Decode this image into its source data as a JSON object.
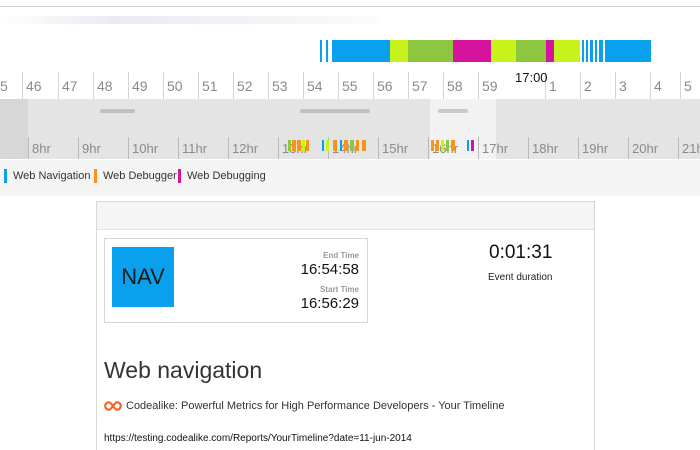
{
  "colors": {
    "web_navigation": "#09a1ee",
    "web_debugger": "#f7941d",
    "web_debugging": "#d6139e",
    "lime": "#c8f21c",
    "olive": "#8dc63f"
  },
  "timeline": {
    "current_time_label": "17:00",
    "minute_labels": [
      "5",
      "46",
      "47",
      "48",
      "49",
      "50",
      "51",
      "52",
      "53",
      "54",
      "55",
      "56",
      "57",
      "58",
      "59",
      "1",
      "2",
      "3",
      "4",
      "5"
    ],
    "hour_labels": [
      "8hr",
      "9hr",
      "10hr",
      "11hr",
      "12hr",
      "13hr",
      "14hr",
      "15hr",
      "16hr",
      "17hr",
      "18hr",
      "19hr",
      "20hr",
      "21h"
    ]
  },
  "legend": [
    {
      "label": "Web Navigation",
      "color_key": "web_navigation"
    },
    {
      "label": "Web Debugger",
      "color_key": "web_debugger"
    },
    {
      "label": "Web Debugging",
      "color_key": "web_debugging"
    }
  ],
  "event": {
    "tile_text": "NAV",
    "end_time_caption": "End Time",
    "end_time": "16:54:58",
    "start_time_caption": "Start Time",
    "start_time": "16:56:29",
    "duration": "0:01:31",
    "duration_caption": "Event duration",
    "title": "Web navigation",
    "site_icon": "codealike-logo-icon",
    "page_title": "Codealike: Powerful Metrics for High Performance Developers - Your Timeline",
    "url": "https://testing.codealike.com/Reports/YourTimeline?date=11-jun-2014"
  }
}
